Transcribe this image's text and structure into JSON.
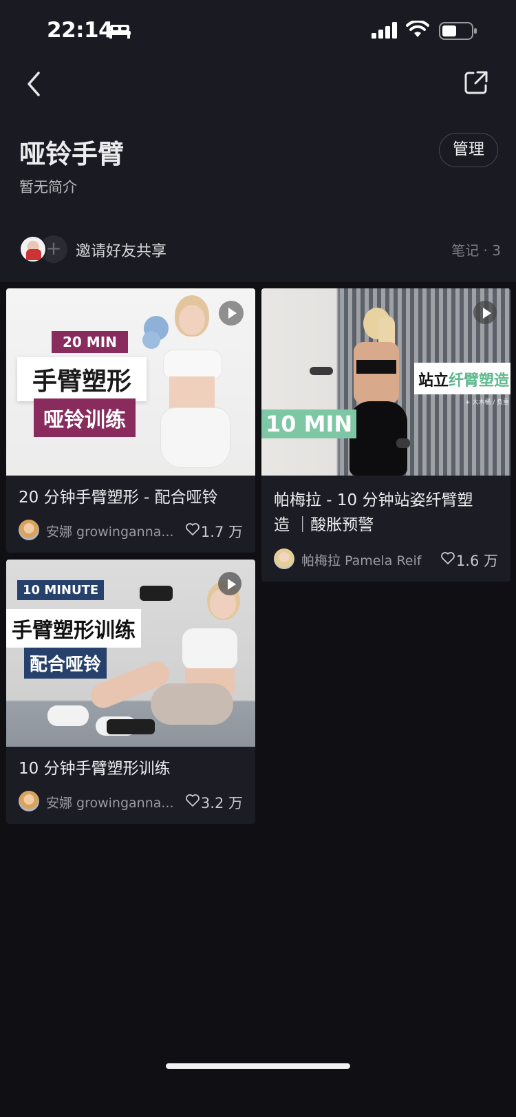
{
  "status_bar": {
    "time": "22:14"
  },
  "album": {
    "title": "哑铃手臂",
    "description": "暂无简介",
    "manage_label": "管理"
  },
  "invite": {
    "text": "邀请好友共享",
    "plus": "+",
    "note_count": "笔记 · 3"
  },
  "notes": [
    {
      "title": "20 分钟手臂塑形 - 配合哑铃",
      "author": "安娜 growinganna...",
      "likes": "1.7 万",
      "thumb": {
        "tag": "20 MIN",
        "line1": "手臂塑形",
        "line2": "哑铃训练",
        "tag_color": "#8a2b5e"
      }
    },
    {
      "title": "帕梅拉 - 10 分钟站姿纤臂塑造 ｜酸胀预警",
      "title_line1": "帕梅拉 - 10 分钟站姿纤臂塑",
      "title_line2": "造 ｜酸胀预警",
      "author": "帕梅拉 Pamela Reif",
      "likes": "1.6 万",
      "thumb": {
        "tag": "10 MIN",
        "line1a": "站立",
        "line1b": "纤臂塑造",
        "sub": "+ 大木桶 / 负重",
        "tag_color": "#7ec7a4"
      }
    },
    {
      "title": "10 分钟手臂塑形训练",
      "author": "安娜 growinganna...",
      "likes": "3.2 万",
      "thumb": {
        "tag": "10 MINUTE",
        "line1": "手臂塑形训练",
        "line2": "配合哑铃",
        "tag_color": "#26416b"
      }
    }
  ],
  "colors": {
    "background": "#0f0f14",
    "header": "#1a1a22",
    "card": "#1c1c24",
    "accent_green": "#7ec7a4"
  },
  "icons": [
    "back-arrow-icon",
    "share-external-icon",
    "play-icon",
    "heart-outline-icon",
    "signal-icon",
    "wifi-icon",
    "battery-icon",
    "bed-icon"
  ]
}
